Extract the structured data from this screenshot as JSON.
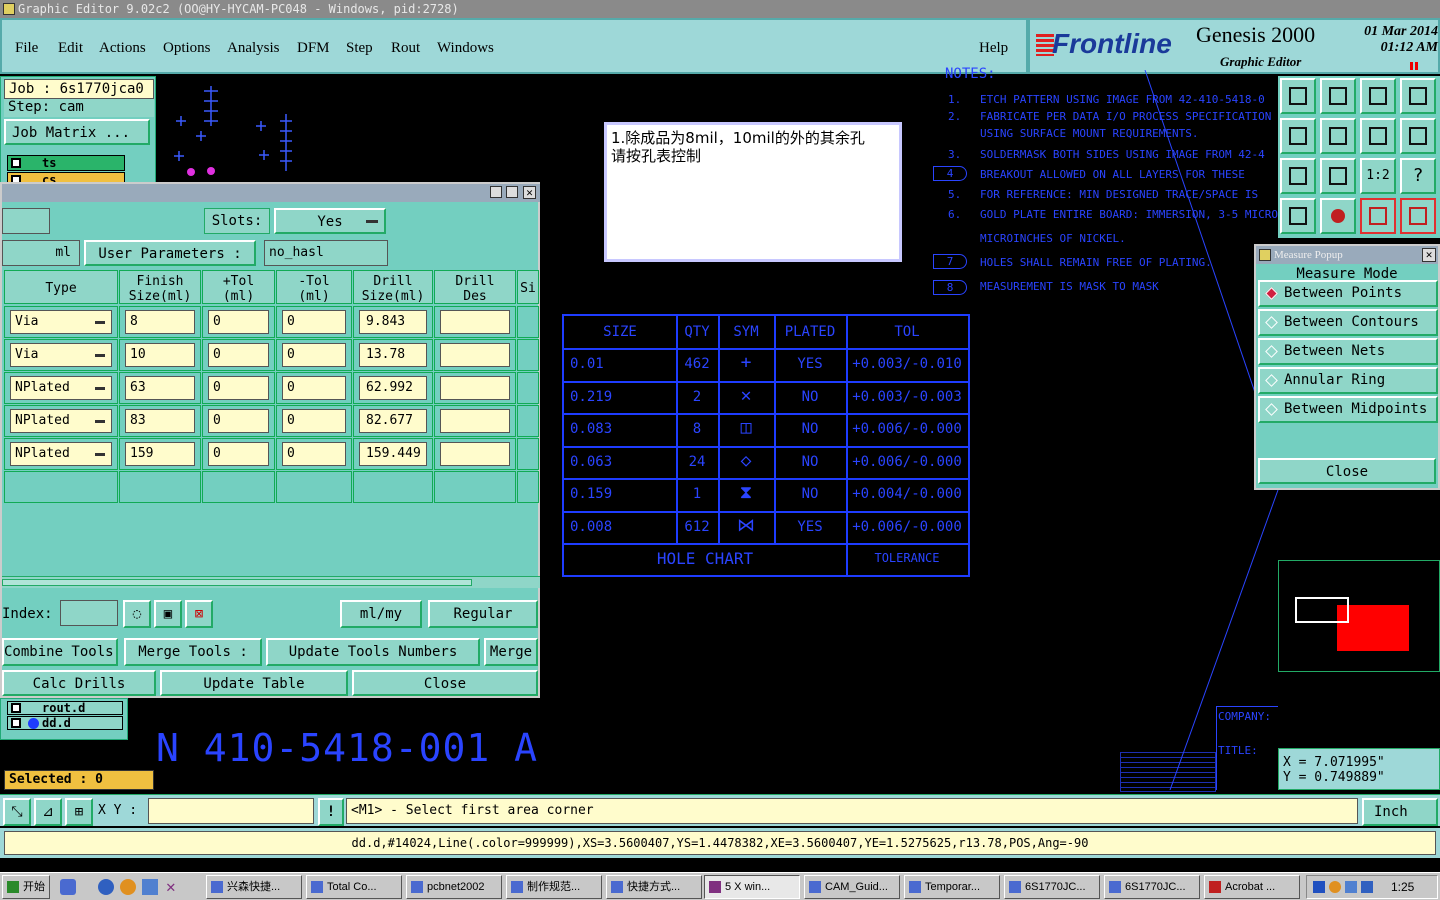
{
  "window": {
    "title": "Graphic Editor 9.02c2 (OO@HY-HYCAM-PC048 - Windows, pid:2728)"
  },
  "menu": {
    "file": "File",
    "edit": "Edit",
    "actions": "Actions",
    "options": "Options",
    "analysis": "Analysis",
    "dfm": "DFM",
    "step": "Step",
    "rout": "Rout",
    "windows": "Windows",
    "help": "Help"
  },
  "brand": {
    "logo": "Frontline",
    "product": "Genesis 2000",
    "subtitle": "Graphic Editor",
    "date": "01 Mar 2014",
    "time": "01:12 AM"
  },
  "job": {
    "job_label": "Job : 6s1770jca0",
    "step_label": "Step: cam",
    "matrix_btn": "Job Matrix ...",
    "layer1": "ts",
    "layer2": "cs",
    "layer_rout": "rout.d",
    "layer_dd": "dd.d",
    "selected": "Selected : 0"
  },
  "drill": {
    "slots_label": "Slots:",
    "slots_value": "Yes",
    "units_suffix": "ml",
    "user_params_btn": "User Parameters :",
    "user_params_value": "no_hasl",
    "headers": [
      "Type",
      "Finish\nSize(ml)",
      "+Tol\n(ml)",
      "-Tol\n(ml)",
      "Drill\nSize(ml)",
      "Drill\nDes",
      "Si"
    ],
    "rows": [
      {
        "type": "Via",
        "finish": "8",
        "ptol": "0",
        "ntol": "0",
        "drill": "9.843"
      },
      {
        "type": "Via",
        "finish": "10",
        "ptol": "0",
        "ntol": "0",
        "drill": "13.78"
      },
      {
        "type": "NPlated",
        "finish": "63",
        "ptol": "0",
        "ntol": "0",
        "drill": "62.992"
      },
      {
        "type": "NPlated",
        "finish": "83",
        "ptol": "0",
        "ntol": "0",
        "drill": "82.677"
      },
      {
        "type": "NPlated",
        "finish": "159",
        "ptol": "0",
        "ntol": "0",
        "drill": "159.449"
      }
    ],
    "index_label": "Index:",
    "units_sel": "ml/my",
    "mode_sel": "Regular",
    "combine": "Combine Tools",
    "merge_tools": "Merge Tools :",
    "update_numbers": "Update Tools Numbers",
    "merge": "Merge",
    "calc": "Calc Drills",
    "update_table": "Update Table",
    "close": "Close"
  },
  "note": {
    "line1": "1.除成品为8mil，10mil的外的其余孔",
    "line2": "请按孔表控制"
  },
  "notes": {
    "heading": "NOTES:",
    "n1": "ETCH PATTERN USING IMAGE FROM 42-410-5418-0",
    "n2a": "FABRICATE PER DATA I/O PROCESS SPECIFICATION",
    "n2b": "USING SURFACE MOUNT REQUIREMENTS.",
    "n3": "SOLDERMASK BOTH SIDES USING IMAGE FROM 42-4",
    "n4": "BREAKOUT ALLOWED ON ALL LAYERS FOR THESE",
    "n5": "FOR REFERENCE: MIN DESIGNED TRACE/SPACE IS",
    "n6a": "GOLD PLATE ENTIRE BOARD: IMMERSION, 3-5 MICRO",
    "n6b": "MICROINCHES OF NICKEL.",
    "n7": "HOLES SHALL REMAIN FREE OF PLATING.",
    "n8": "MEASUREMENT IS MASK TO MASK",
    "num1": "1.",
    "num2": "2.",
    "num3": "3.",
    "num4": "4",
    "num5": "5.",
    "num6": "6.",
    "num7": "7",
    "num8": "8"
  },
  "holechart": {
    "headers": [
      "SIZE",
      "QTY",
      "SYM",
      "PLATED",
      "TOL"
    ],
    "rows": [
      {
        "size": "0.01",
        "qty": "462",
        "sym": "+",
        "plated": "YES",
        "tol": "+0.003/-0.010"
      },
      {
        "size": "0.219",
        "qty": "2",
        "sym": "✕",
        "plated": "NO",
        "tol": "+0.003/-0.003"
      },
      {
        "size": "0.083",
        "qty": "8",
        "sym": "◫",
        "plated": "NO",
        "tol": "+0.006/-0.000"
      },
      {
        "size": "0.063",
        "qty": "24",
        "sym": "◇",
        "plated": "NO",
        "tol": "+0.006/-0.000"
      },
      {
        "size": "0.159",
        "qty": "1",
        "sym": "⧗",
        "plated": "NO",
        "tol": "+0.004/-0.000"
      },
      {
        "size": "0.008",
        "qty": "612",
        "sym": "⋈",
        "plated": "YES",
        "tol": "+0.006/-0.000"
      }
    ],
    "footer": "HOLE CHART",
    "tolerance": "TOLERANCE"
  },
  "partnum": "N 410-5418-001 A",
  "titleblock": {
    "company": "COMPANY:",
    "title": "TITLE:"
  },
  "measure": {
    "title": "Measure Popup",
    "mode": "Measure Mode",
    "opt1": "Between Points",
    "opt2": "Between Contours",
    "opt3": "Between Nets",
    "opt4": "Annular Ring",
    "opt5": "Between Midpoints",
    "close": "Close"
  },
  "coords": {
    "x": "X = 7.071995\"",
    "y": "Y = 0.749889\""
  },
  "status": {
    "xy_label": "X Y :",
    "prompt": "<M1> - Select first area corner",
    "units": "Inch",
    "info": "dd.d,#14024,Line(.color=999999),XS=3.5600407,YS=1.4478382,XE=3.5600407,YE=1.5275625,r13.78,POS,Ang=-90"
  },
  "taskbar": {
    "start": "开始",
    "t1": "兴森快捷...",
    "t2": "Total Co...",
    "t3": "pcbnet2002",
    "t4": "制作规范...",
    "t5": "快捷方式...",
    "t6": "5 X win...",
    "t7": "CAM_Guid...",
    "t8": "Temporar...",
    "t9": "6S1770JC...",
    "t10": "6S1770JC...",
    "t11": "Acrobat ...",
    "clock": "1:25"
  },
  "colors": {
    "bg": "#000000",
    "panel": "#73cfc0",
    "field": "#fffccc",
    "blue": "#1e3cff",
    "accent_red": "#ff0000"
  }
}
